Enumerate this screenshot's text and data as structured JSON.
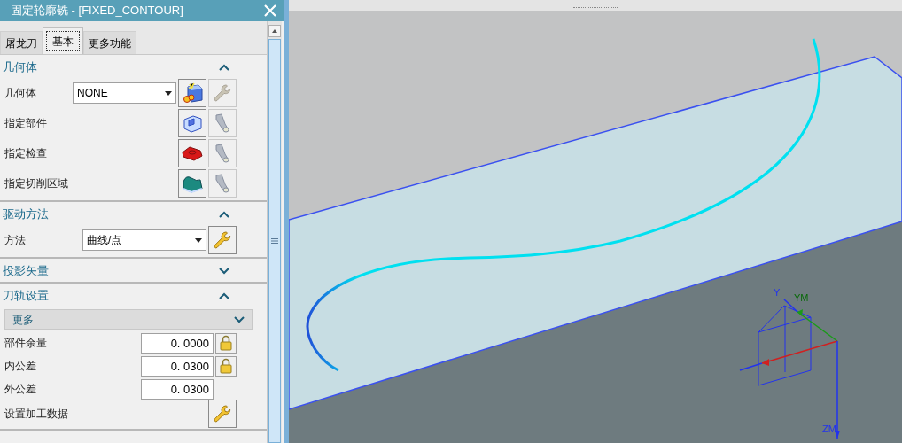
{
  "window": {
    "title": "固定轮廓铣 - [FIXED_CONTOUR]"
  },
  "tabs": [
    {
      "label": "屠龙刀",
      "selected": false
    },
    {
      "label": "基本",
      "selected": true
    },
    {
      "label": "更多功能",
      "selected": false
    }
  ],
  "sections": [
    {
      "title": "几何体",
      "expanded": true,
      "rows": [
        {
          "kind": "select",
          "label": "几何体",
          "value": "NONE"
        },
        {
          "kind": "pick",
          "label": "指定部件"
        },
        {
          "kind": "pick",
          "label": "指定检查"
        },
        {
          "kind": "pick",
          "label": "指定切削区域"
        }
      ]
    },
    {
      "title": "驱动方法",
      "expanded": true,
      "rows": [
        {
          "kind": "select",
          "label": "方法",
          "value": "曲线/点"
        }
      ]
    },
    {
      "title": "投影矢量",
      "expanded": false
    },
    {
      "title": "刀轨设置",
      "expanded": true,
      "more": {
        "label": "更多",
        "expanded": false
      },
      "rows": [
        {
          "kind": "number",
          "label": "部件余量",
          "value": "0. 0000",
          "lock": true
        },
        {
          "kind": "number",
          "label": "内公差",
          "value": "0. 0300",
          "lock": true
        },
        {
          "kind": "number",
          "label": "外公差",
          "value": "0. 0300",
          "lock": false
        },
        {
          "kind": "button",
          "label": "设置加工数据"
        }
      ]
    }
  ],
  "viewport": {
    "axis_labels": [
      "Y",
      "YM",
      "ZM"
    ]
  }
}
